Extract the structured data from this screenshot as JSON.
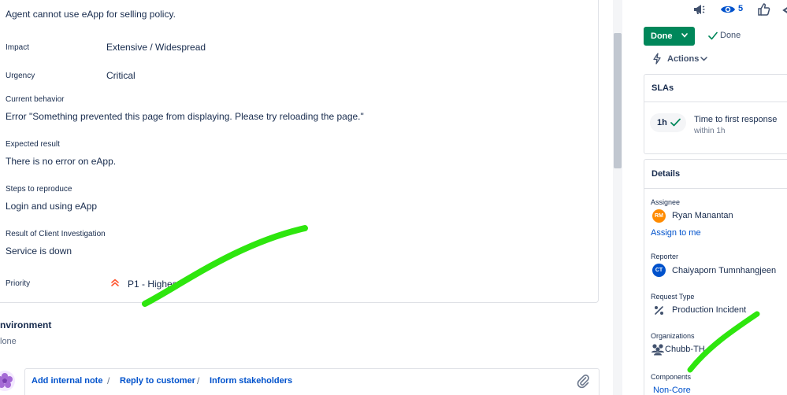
{
  "issue": {
    "description": "Agent cannot use eApp for selling policy.",
    "fields": [
      {
        "label": "Impact",
        "value": "Extensive / Widespread"
      },
      {
        "label": "Urgency",
        "value": "Critical"
      }
    ],
    "sections": [
      {
        "label": "Current behavior",
        "value": "Error \"Something prevented this page from displaying. Please try reloading the page.\""
      },
      {
        "label": "Expected result",
        "value": "There is no error on eApp."
      },
      {
        "label": "Steps to reproduce",
        "value": "Login and using eApp"
      },
      {
        "label": "Result of Client Investigation",
        "value": "Service is down"
      }
    ],
    "priority": {
      "label": "Priority",
      "value": "P1 - Highest",
      "icon": "priority-highest-icon",
      "color": "#ff5630"
    }
  },
  "environment": {
    "title": "Environment",
    "value": "None",
    "title_visible": "nvironment",
    "value_visible": "lone"
  },
  "comment_bar": {
    "add_internal_note": "Add internal note",
    "reply_to_customer": "Reply to customer",
    "inform_stakeholders": "Inform stakeholders",
    "separator": "/"
  },
  "header_actions": {
    "watch_count": "5"
  },
  "status": {
    "button_label": "Done",
    "current": "Done",
    "button_color": "#00875a"
  },
  "actions_label": "Actions",
  "slas": {
    "title": "SLAs",
    "pill": "1h",
    "name": "Time to first response",
    "target": "within 1h"
  },
  "details": {
    "title": "Details",
    "assignee": {
      "label": "Assignee",
      "initials": "RM",
      "name": "Ryan Manantan",
      "avatar_color": "#ff8b00",
      "assign_link": "Assign to me"
    },
    "reporter": {
      "label": "Reporter",
      "initials": "CT",
      "name": "Chaiyaporn Tumnhangjeen",
      "avatar_color": "#0052cc"
    },
    "request_type": {
      "label": "Request Type",
      "value": "Production Incident"
    },
    "organizations": {
      "label": "Organizations",
      "value": "Chubb-TH"
    },
    "components": {
      "label": "Components",
      "value": "Non-Core"
    }
  },
  "colors": {
    "link": "#0052cc",
    "annotation": "#2ee60e"
  }
}
